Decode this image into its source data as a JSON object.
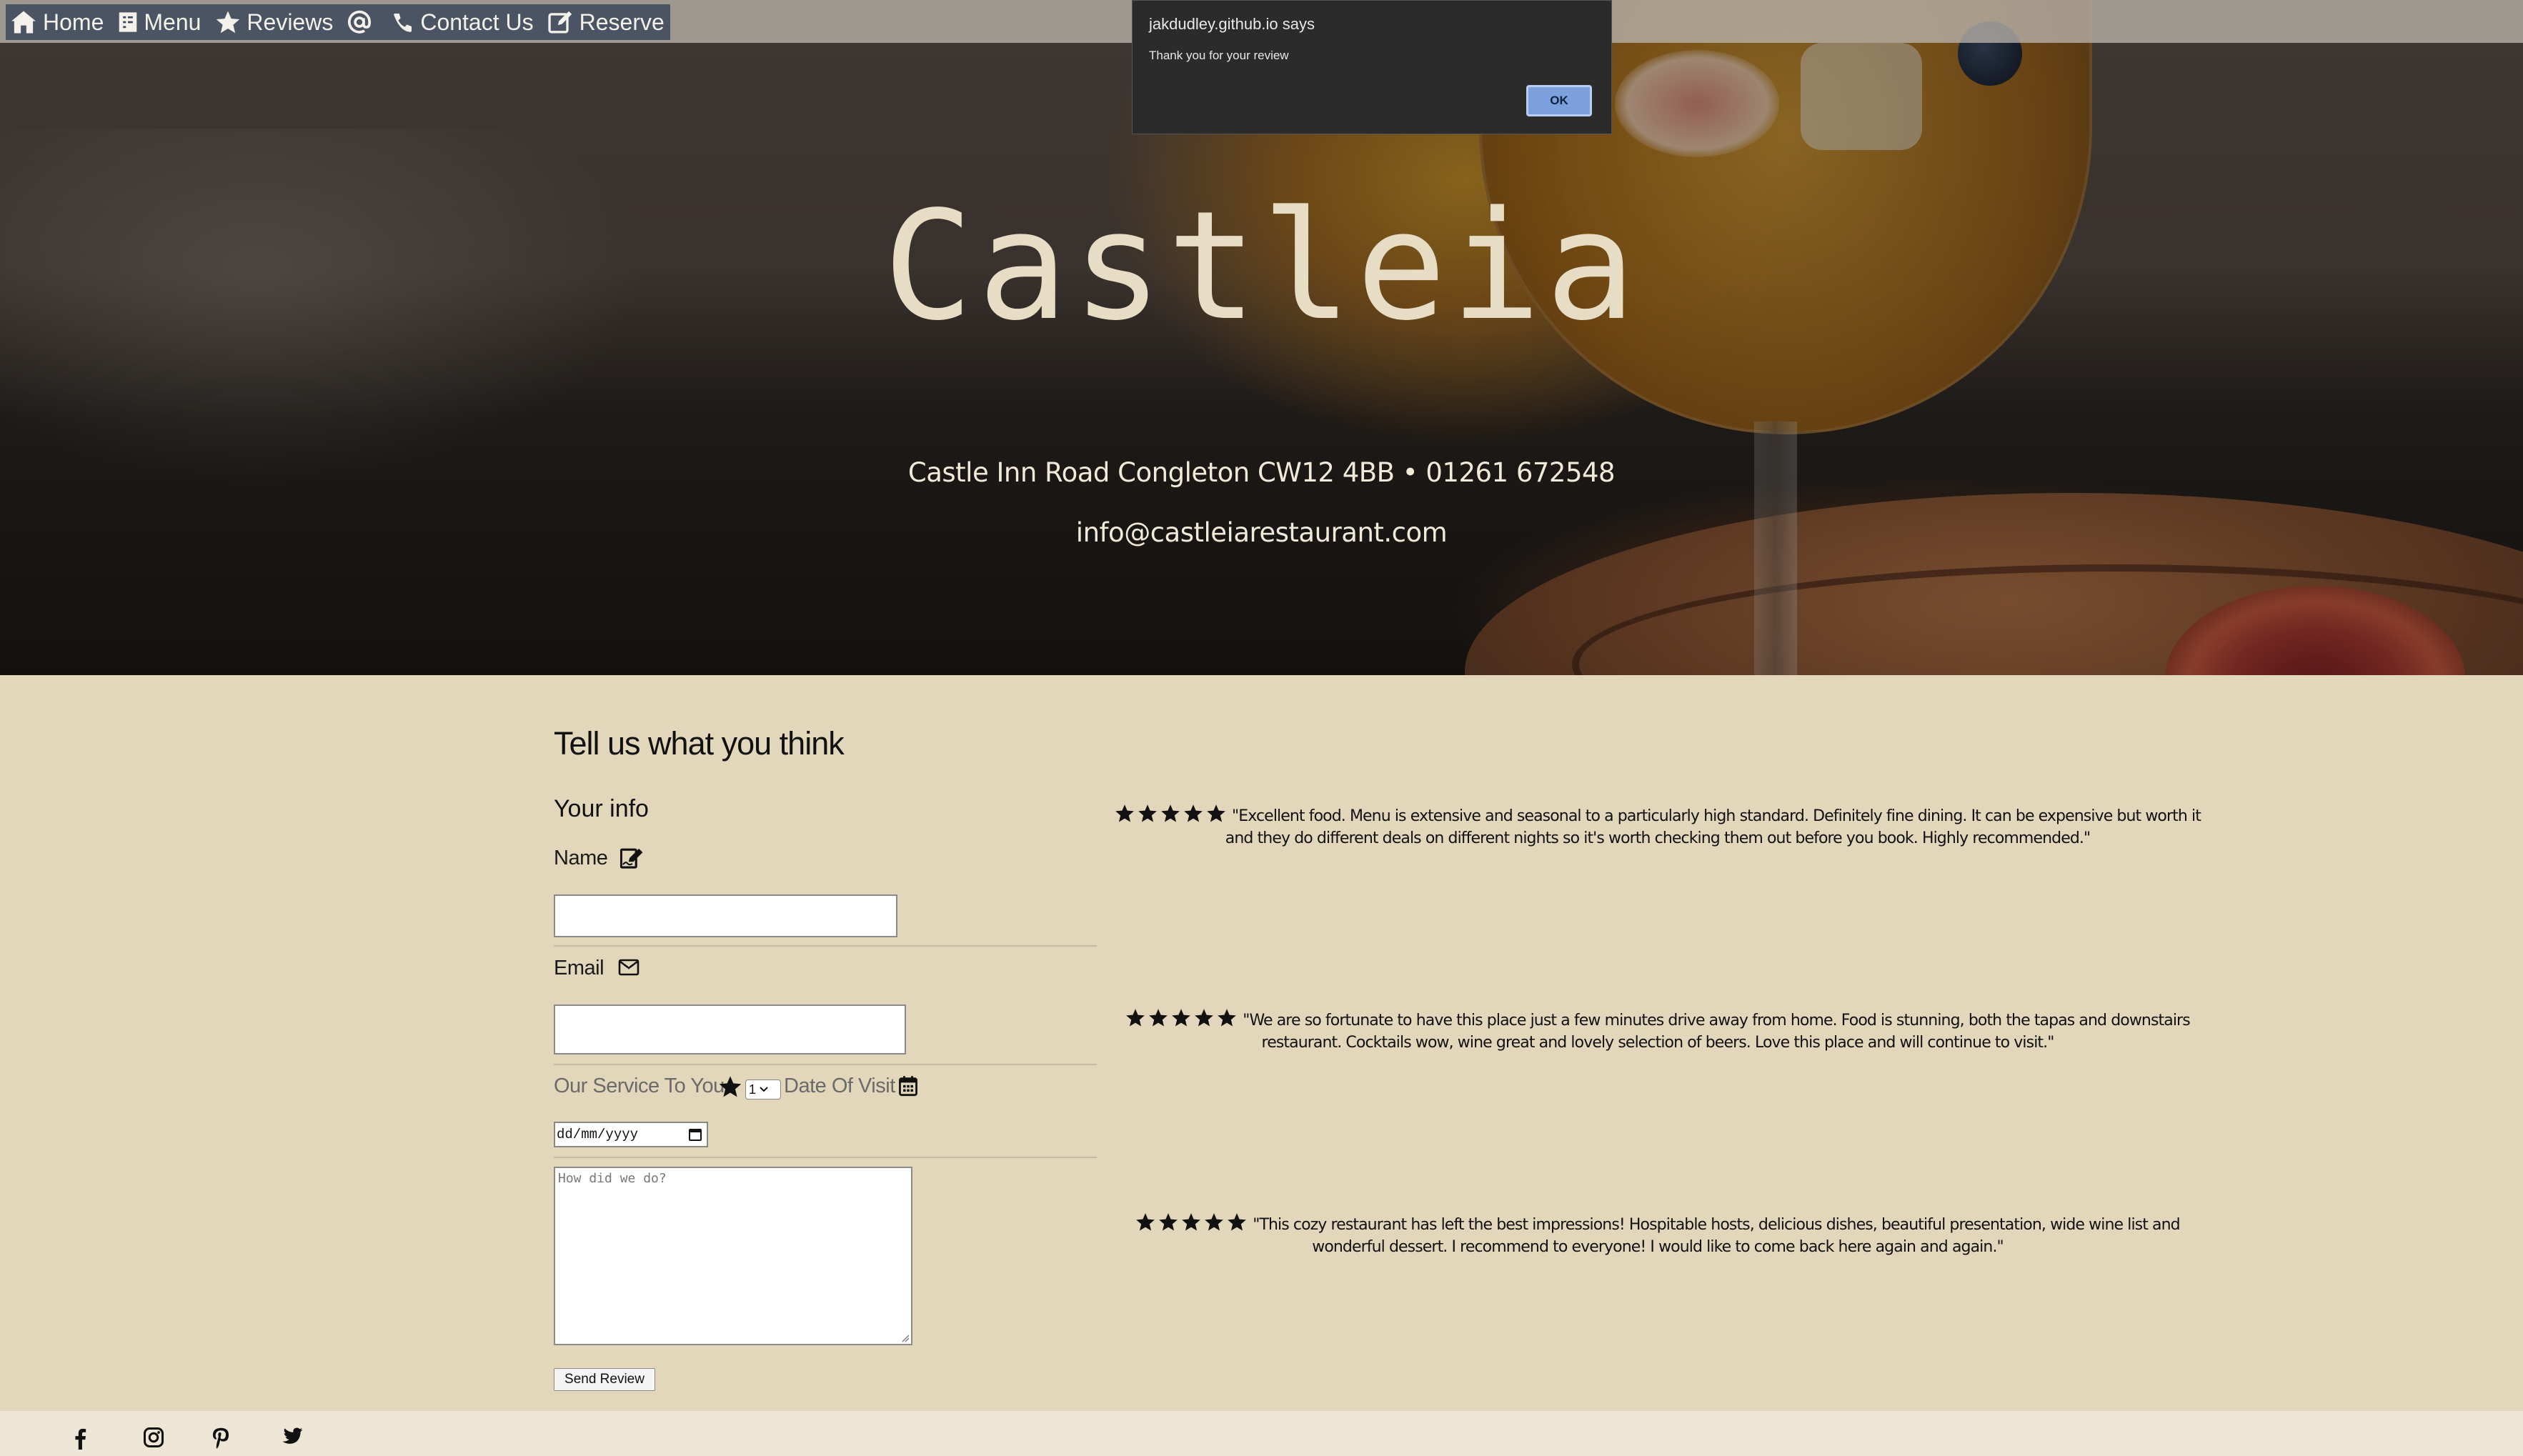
{
  "nav": {
    "items": [
      {
        "label": "Home",
        "icon": "home-icon"
      },
      {
        "label": "Menu",
        "icon": "menu-book-icon"
      },
      {
        "label": "Reviews",
        "icon": "star-icon"
      },
      {
        "label": "",
        "icon": "at-icon"
      },
      {
        "label": "Contact Us",
        "icon": "phone-icon"
      },
      {
        "label": "Reserve",
        "icon": "edit-icon"
      }
    ]
  },
  "alert": {
    "title": "jakdudley.github.io says",
    "message": "Thank you for your review",
    "ok_label": "OK"
  },
  "hero": {
    "brand": "Castleia",
    "address": "Castle Inn Road Congleton CW12 4BB • 01261 672548",
    "email": "info@castleiarestaurant.com"
  },
  "form": {
    "title": "Tell us what you think",
    "subtitle": "Your info",
    "name_label": "Name",
    "email_label": "Email",
    "service_label": "Our Service To You",
    "rating_value": "1",
    "date_label": "Date Of Visit",
    "date_placeholder": "dd/mm/yyyy",
    "review_placeholder": "How did we do?",
    "submit_label": "Send Review"
  },
  "reviews": [
    {
      "stars": 5,
      "text": "\"Excellent food. Menu is extensive and seasonal to a particularly high standard. Definitely fine dining. It can be expensive but worth it and they do different deals on different nights so it's worth checking them out before you book. Highly recommended.\""
    },
    {
      "stars": 5,
      "text": "\"We are so fortunate to have this place just a few minutes drive away from home. Food is stunning, both the tapas and downstairs restaurant. Cocktails wow, wine great and lovely selection of beers. Love this place and will continue to visit.\""
    },
    {
      "stars": 5,
      "text": "\"This cozy restaurant has left the best impressions! Hospitable hosts, delicious dishes, beautiful presentation, wide wine list and wonderful dessert. I recommend to everyone! I would like to come back here again and again.\""
    }
  ],
  "footer": {
    "social": [
      "facebook-icon",
      "instagram-icon",
      "pinterest-icon",
      "twitter-icon"
    ]
  },
  "colors": {
    "page_bg": "#e2d6bb",
    "brand_text": "#e7dcc4",
    "footer_bg": "#ede5d5",
    "alert_bg": "#2b2b2c",
    "ok_button": "#7ba0dc"
  }
}
